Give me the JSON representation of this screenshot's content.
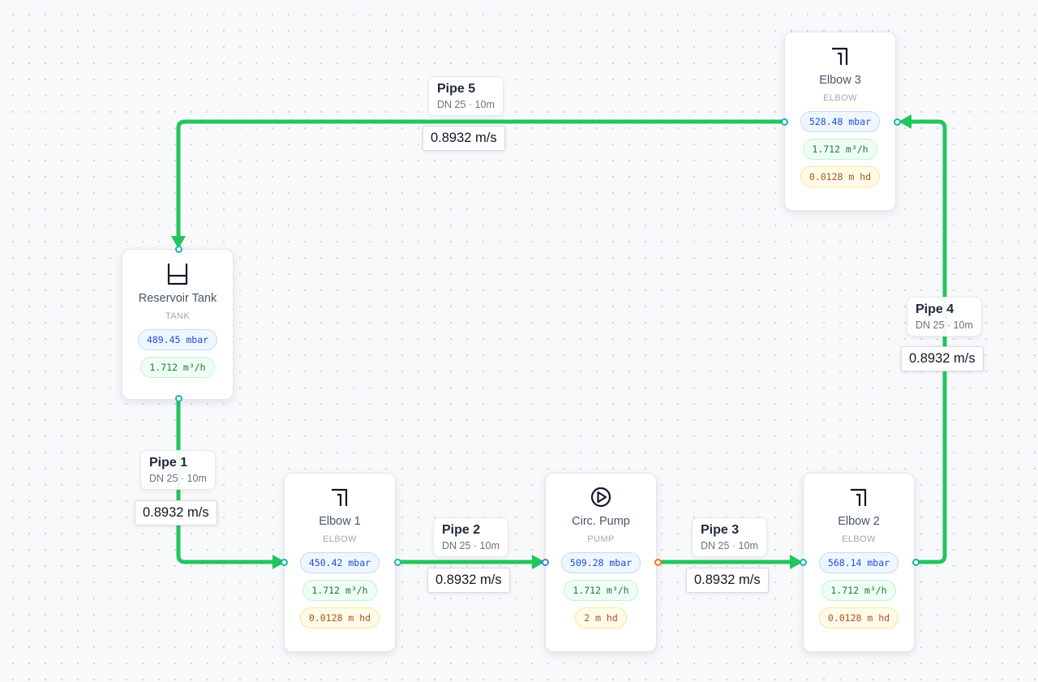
{
  "colors": {
    "pipe": "#22c55e",
    "handle": "#14b8a6",
    "pump_inlet": "#3b82f6",
    "pump_outlet": "#f97316"
  },
  "nodes": {
    "tank": {
      "title": "Reservoir Tank",
      "type": "TANK",
      "icon": "tank-icon",
      "pressure": "489.45 mbar",
      "flow": "1.712 m³/h"
    },
    "elbow1": {
      "title": "Elbow 1",
      "type": "ELBOW",
      "icon": "elbow-icon",
      "pressure": "450.42 mbar",
      "flow": "1.712 m³/h",
      "head": "0.0128 m hd"
    },
    "pump": {
      "title": "Circ. Pump",
      "type": "PUMP",
      "icon": "pump-icon",
      "pressure": "509.28 mbar",
      "flow": "1.712 m³/h",
      "head": "2 m hd"
    },
    "elbow2": {
      "title": "Elbow 2",
      "type": "ELBOW",
      "icon": "elbow-icon",
      "pressure": "568.14 mbar",
      "flow": "1.712 m³/h",
      "head": "0.0128 m hd"
    },
    "elbow3": {
      "title": "Elbow 3",
      "type": "ELBOW",
      "icon": "elbow-icon",
      "pressure": "528.48 mbar",
      "flow": "1.712 m³/h",
      "head": "0.0128 m hd"
    }
  },
  "pipes": {
    "pipe1": {
      "name": "Pipe 1",
      "spec": "DN 25 · 10m",
      "velocity": "0.8932 m/s"
    },
    "pipe2": {
      "name": "Pipe 2",
      "spec": "DN 25 · 10m",
      "velocity": "0.8932 m/s"
    },
    "pipe3": {
      "name": "Pipe 3",
      "spec": "DN 25 · 10m",
      "velocity": "0.8932 m/s"
    },
    "pipe4": {
      "name": "Pipe 4",
      "spec": "DN 25 · 10m",
      "velocity": "0.8932 m/s"
    },
    "pipe5": {
      "name": "Pipe 5",
      "spec": "DN 25 · 10m",
      "velocity": "0.8932 m/s"
    }
  }
}
